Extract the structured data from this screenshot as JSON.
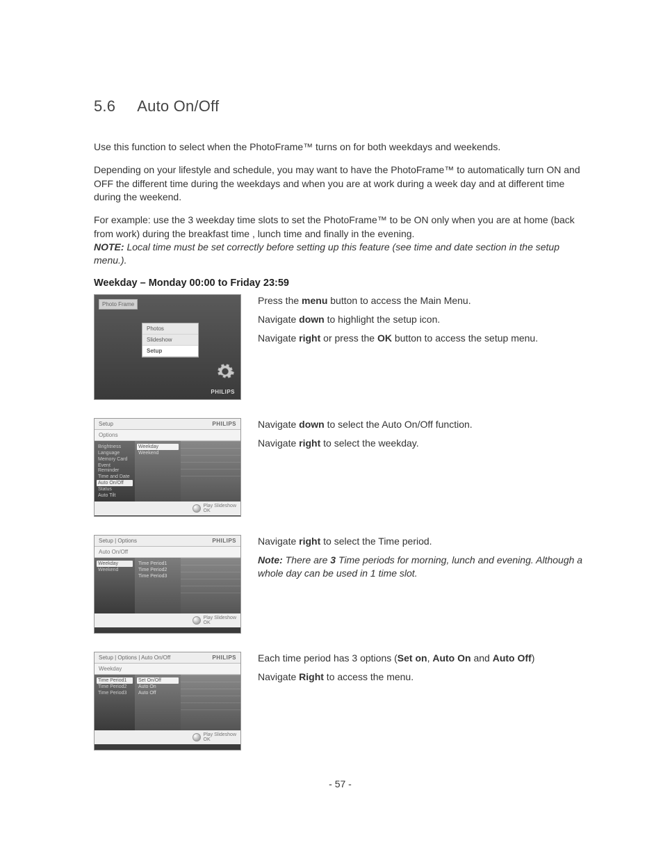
{
  "section": {
    "number": "5.6",
    "title": "Auto On/Off"
  },
  "intro": {
    "p1": "Use this function to select when the PhotoFrame™ turns on for both weekdays and weekends.",
    "p2": "Depending on your lifestyle and schedule, you may want to have the PhotoFrame™ to automatically turn ON and OFF the different time during the weekdays and when you are at work during a week day and at different time during the weekend.",
    "p3": "For example: use the 3 weekday time slots to set the PhotoFrame™ to be ON only when you are at home (back from work) during the breakfast time , lunch time and finally in the evening.",
    "note_label": "NOTE:",
    "note_text": " Local time must be set correctly before setting up this feature (see time and date section in the setup menu.)."
  },
  "subhead": "Weekday – Monday 00:00 to Friday 23:59",
  "shot1": {
    "tag": "Photo Frame",
    "menu": [
      "Photos",
      "Slideshow",
      "Setup"
    ],
    "brand": "PHILIPS"
  },
  "step1": {
    "a_pre": "Press the ",
    "a_b": "menu",
    "a_post": " button to access the Main Menu.",
    "b_pre": "Navigate ",
    "b_b": "down",
    "b_post": " to highlight the setup icon.",
    "c_pre": "Navigate ",
    "c_b1": "right",
    "c_mid": " or press the ",
    "c_b2": "OK",
    "c_post": " button to access the setup menu."
  },
  "shot2": {
    "hdr": "Setup",
    "sub": "Options",
    "col1": [
      "Brightness",
      "Language",
      "Memory Card",
      "Event Reminder",
      "Time and Date",
      "Auto On/Off",
      "Status",
      "Auto Tilt"
    ],
    "col1_sel": 5,
    "col2": [
      "Weekday",
      "Weekend"
    ],
    "col2_sel": 0,
    "ftr1": "Play Slideshow",
    "ftr2": "OK"
  },
  "step2": {
    "a_pre": "Navigate ",
    "a_b": "down",
    "a_post": " to select the Auto On/Off function.",
    "b_pre": "Navigate ",
    "b_b": "right",
    "b_post": " to select the weekday."
  },
  "shot3": {
    "hdr": "Setup | Options",
    "sub": "Auto On/Off",
    "col1": [
      "Weekday",
      "Weekend"
    ],
    "col1_sel": 0,
    "col2": [
      "Time Period1",
      "Time Period2",
      "Time Period3"
    ],
    "col2_sel": -1,
    "ftr1": "Play Slideshow",
    "ftr2": "OK"
  },
  "step3": {
    "a_pre": "Navigate ",
    "a_b": "right",
    "a_post": " to select the Time period.",
    "note_label": "Note:",
    "note_mid_pre": " There are ",
    "note_mid_b": "3",
    "note_mid_post": " Time periods for morning, lunch and evening. Although a whole day can be used in 1 time slot."
  },
  "shot4": {
    "hdr": "Setup | Options | Auto On/Off",
    "sub": "Weekday",
    "col1": [
      "Time Period1",
      "Time Period2",
      "Time Period3"
    ],
    "col1_sel": 0,
    "col2": [
      "Set On/Off",
      "Auto On",
      "Auto Off"
    ],
    "col2_sel": 0,
    "ftr1": "Play Slideshow",
    "ftr2": "OK"
  },
  "step4": {
    "a_pre": "Each time period has 3 options (",
    "a_b1": "Set on",
    "a_mid1": ", ",
    "a_b2": "Auto On",
    "a_mid2": " and ",
    "a_b3": "Auto Off",
    "a_post": ")",
    "b_pre": "Navigate ",
    "b_b": "Right",
    "b_post": " to access the menu."
  },
  "brand": "PHILIPS",
  "pagenum": "- 57 -"
}
